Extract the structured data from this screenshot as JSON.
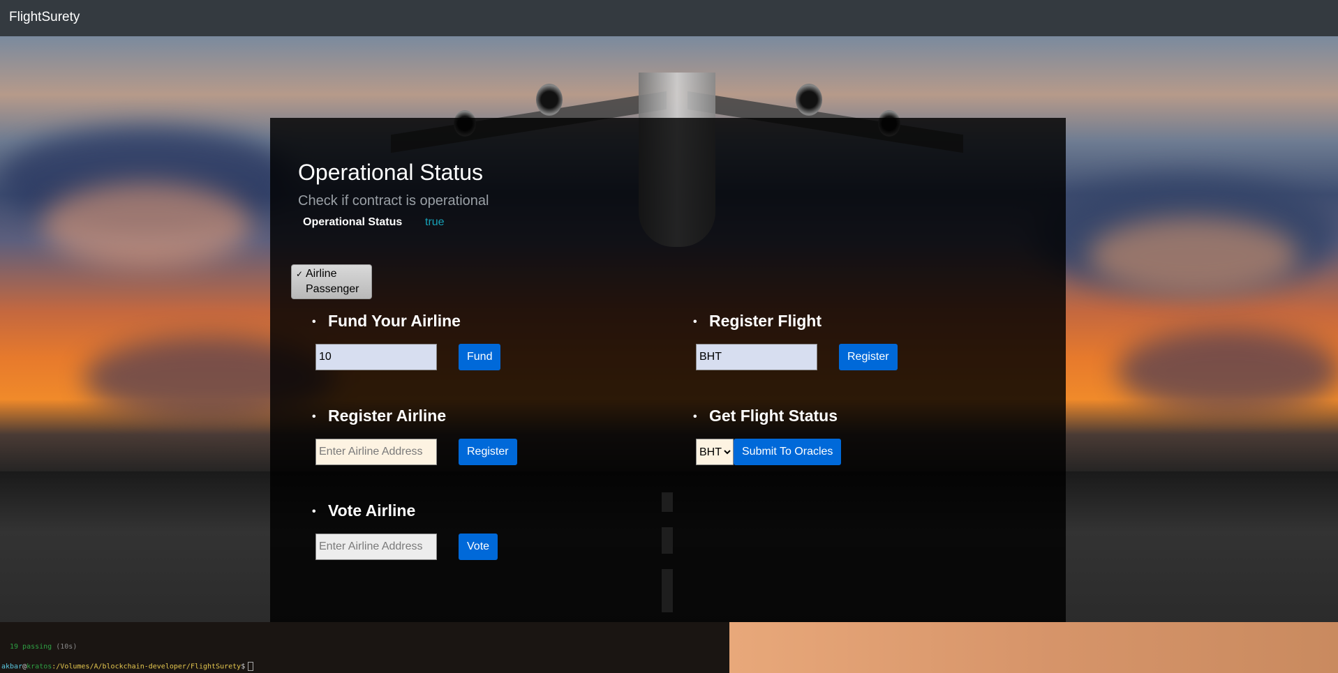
{
  "navbar": {
    "brand": "FlightSurety"
  },
  "operational": {
    "title": "Operational Status",
    "subtitle": "Check if contract is operational",
    "label": "Operational Status",
    "value": "true"
  },
  "role_select": {
    "options": [
      "Airline",
      "Passenger"
    ],
    "selected": "Airline"
  },
  "fund": {
    "heading": "Fund Your Airline",
    "input_value": "10",
    "button_label": "Fund"
  },
  "register_airline": {
    "heading": "Register Airline",
    "placeholder": "Enter Airline Address",
    "button_label": "Register"
  },
  "vote_airline": {
    "heading": "Vote Airline",
    "placeholder": "Enter Airline Address",
    "button_label": "Vote"
  },
  "register_flight": {
    "heading": "Register Flight",
    "input_value": "BHT",
    "button_label": "Register"
  },
  "flight_status": {
    "heading": "Get Flight Status",
    "selected_flight": "BHT",
    "button_label": "Submit To Oracles"
  },
  "terminal": {
    "passing": "19 passing",
    "duration": "(10s)",
    "user": "akbar",
    "host": "kratos",
    "path": ":/Volumes/A/blockchain-developer/FlightSurety",
    "prompt_symbol": "$"
  },
  "colors": {
    "navbar": "#343a40",
    "accent": "#0069d9",
    "status_value": "#17a2b8"
  }
}
